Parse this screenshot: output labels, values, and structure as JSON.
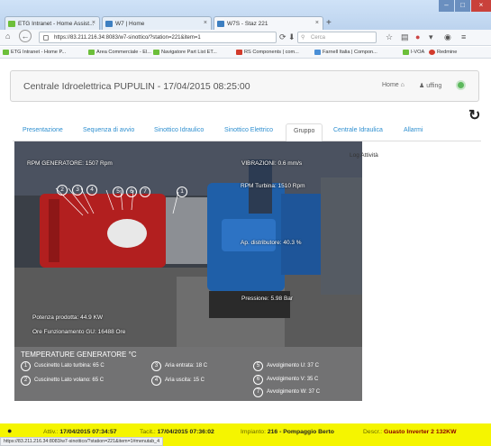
{
  "browser": {
    "tabs": [
      {
        "label": "ETG Intranet - Home Assist..."
      },
      {
        "label": "W7 | Home"
      },
      {
        "label": "W7S - Staz 221"
      }
    ],
    "url": "https://83.211.216.34:8083/w7-sinottico/?station=221&item=1",
    "search_placeholder": "Cerca",
    "bookmarks": [
      "ETG Intranet - Home P...",
      "Area Commerciale - El...",
      "Navigatore Part List ET...",
      "RS Components | com...",
      "Farnell Italia | Compon...",
      "I-VOA",
      "Redmine"
    ],
    "status_url": "https://83.211.216.34:8083/w7-sinottico/?station=221&item=1#menutab_4"
  },
  "header": {
    "title": "Centrale Idroelettrica PUPULIN - 17/04/2015 08:25:00",
    "home_label": "Home",
    "user_label": "uffing"
  },
  "tabs": [
    {
      "label": "Presentazione"
    },
    {
      "label": "Sequenza di avvio"
    },
    {
      "label": "Sinottico Idraulico"
    },
    {
      "label": "Sinottico Elettrico"
    },
    {
      "label": "Gruppo"
    },
    {
      "label": "Centrale Idraulica"
    },
    {
      "label": "Allarmi"
    }
  ],
  "active_tab": "Gruppo",
  "overlay": {
    "rpm_generatore": "RPM GENERATORE: 1507 Rpm",
    "vibrazioni": "VIBRAZIONI: 0.6 mm/s",
    "rpm_turbina": "RPM Turbina: 1510 Rpm",
    "ap_distributore": "Ap. distributore: 40.3 %",
    "pressione": "Pressione: 5.98 Bar",
    "potenza": "Potenza prodotta: 44.9 KW",
    "ore": "Ore Funzionamento GU: 16488 Ore",
    "markers": [
      "2",
      "3",
      "4",
      "5",
      "6",
      "7",
      "1"
    ]
  },
  "temperature": {
    "title": "TEMPERATURE GENERATORE °C",
    "items": [
      {
        "n": "1",
        "label": "Cuscinetto Lato turbina: 65 C"
      },
      {
        "n": "2",
        "label": "Cuscinetto Lato volano: 65 C"
      },
      {
        "n": "3",
        "label": "Aria entrata: 18 C"
      },
      {
        "n": "4",
        "label": "Aria uscita: 15 C"
      },
      {
        "n": "5",
        "label": "Avvolgimento U: 37 C"
      },
      {
        "n": "6",
        "label": "Avvolgimento V: 35 C"
      },
      {
        "n": "7",
        "label": "Avvolgimento W: 37 C"
      }
    ]
  },
  "log_label": "Log Attività",
  "status": {
    "attiv_label": "Attiv.:",
    "attiv_value": "17/04/2015 07:34:57",
    "tacit_label": "Tacit.:",
    "tacit_value": "17/04/2015 07:36:02",
    "impianto_label": "Impianto:",
    "impianto_value": "216 - Pompaggio Berto",
    "descr_label": "Descr.:",
    "descr_value": "Guasto Inverter 2 132KW"
  }
}
